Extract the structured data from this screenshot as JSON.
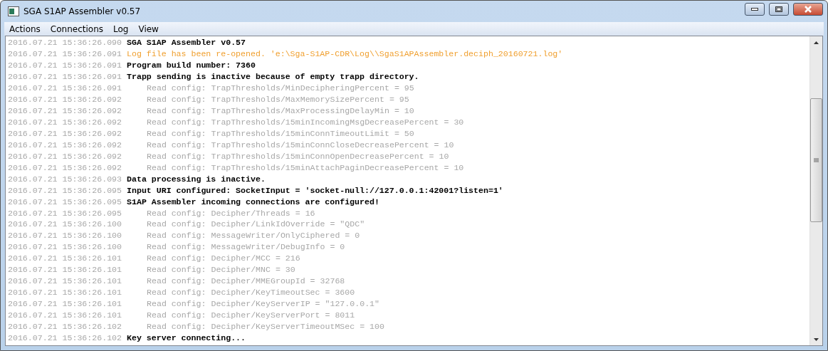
{
  "window": {
    "title": "SGA S1AP Assembler v0.57"
  },
  "menu": [
    "Actions",
    "Connections",
    "Log",
    "View"
  ],
  "log": [
    {
      "time": "2016.07.21 15:36:26.090",
      "kind": "info",
      "text": "SGA S1AP Assembler v0.57"
    },
    {
      "time": "2016.07.21 15:36:26.091",
      "kind": "notice",
      "text": "Log file has been re-opened. 'e:\\Sga-S1AP-CDR\\Log\\\\SgaS1APAssembler.deciph_20160721.log'"
    },
    {
      "time": "2016.07.21 15:36:26.091",
      "kind": "info",
      "text": "Program build number: 7360"
    },
    {
      "time": "2016.07.21 15:36:26.091",
      "kind": "info",
      "text": "Trapp sending is inactive because of empty trapp directory."
    },
    {
      "time": "2016.07.21 15:36:26.091",
      "kind": "config",
      "text": "Read config: TrapThresholds/MinDecipheringPercent = 95"
    },
    {
      "time": "2016.07.21 15:36:26.092",
      "kind": "config",
      "text": "Read config: TrapThresholds/MaxMemorySizePercent = 95"
    },
    {
      "time": "2016.07.21 15:36:26.092",
      "kind": "config",
      "text": "Read config: TrapThresholds/MaxProcessingDelayMin = 10"
    },
    {
      "time": "2016.07.21 15:36:26.092",
      "kind": "config",
      "text": "Read config: TrapThresholds/15minIncomingMsgDecreasePercent = 30"
    },
    {
      "time": "2016.07.21 15:36:26.092",
      "kind": "config",
      "text": "Read config: TrapThresholds/15minConnTimeoutLimit = 50"
    },
    {
      "time": "2016.07.21 15:36:26.092",
      "kind": "config",
      "text": "Read config: TrapThresholds/15minConnCloseDecreasePercent = 10"
    },
    {
      "time": "2016.07.21 15:36:26.092",
      "kind": "config",
      "text": "Read config: TrapThresholds/15minConnOpenDecreasePercent = 10"
    },
    {
      "time": "2016.07.21 15:36:26.092",
      "kind": "config",
      "text": "Read config: TrapThresholds/15minAttachPaginDecreasePercent = 10"
    },
    {
      "time": "2016.07.21 15:36:26.093",
      "kind": "info",
      "text": "Data processing is inactive."
    },
    {
      "time": "2016.07.21 15:36:26.095",
      "kind": "info",
      "text": "Input URI configured: SocketInput = 'socket-null://127.0.0.1:42001?listen=1'"
    },
    {
      "time": "2016.07.21 15:36:26.095",
      "kind": "info",
      "text": "S1AP Assembler incoming connections are configured!"
    },
    {
      "time": "2016.07.21 15:36:26.095",
      "kind": "config",
      "text": "Read config: Decipher/Threads = 16"
    },
    {
      "time": "2016.07.21 15:36:26.100",
      "kind": "config",
      "text": "Read config: Decipher/LinkIdOverride = \"QDC\""
    },
    {
      "time": "2016.07.21 15:36:26.100",
      "kind": "config",
      "text": "Read config: MessageWriter/OnlyCiphered = 0"
    },
    {
      "time": "2016.07.21 15:36:26.100",
      "kind": "config",
      "text": "Read config: MessageWriter/DebugInfo = 0"
    },
    {
      "time": "2016.07.21 15:36:26.101",
      "kind": "config",
      "text": "Read config: Decipher/MCC = 216"
    },
    {
      "time": "2016.07.21 15:36:26.101",
      "kind": "config",
      "text": "Read config: Decipher/MNC = 30"
    },
    {
      "time": "2016.07.21 15:36:26.101",
      "kind": "config",
      "text": "Read config: Decipher/MMEGroupId = 32768"
    },
    {
      "time": "2016.07.21 15:36:26.101",
      "kind": "config",
      "text": "Read config: Decipher/KeyTimeoutSec = 3600"
    },
    {
      "time": "2016.07.21 15:36:26.101",
      "kind": "config",
      "text": "Read config: Decipher/KeyServerIP = \"127.0.0.1\""
    },
    {
      "time": "2016.07.21 15:36:26.101",
      "kind": "config",
      "text": "Read config: Decipher/KeyServerPort = 8011"
    },
    {
      "time": "2016.07.21 15:36:26.102",
      "kind": "config",
      "text": "Read config: Decipher/KeyServerTimeoutMSec = 100"
    },
    {
      "time": "2016.07.21 15:36:26.102",
      "kind": "info",
      "text": "Key server connecting..."
    }
  ]
}
